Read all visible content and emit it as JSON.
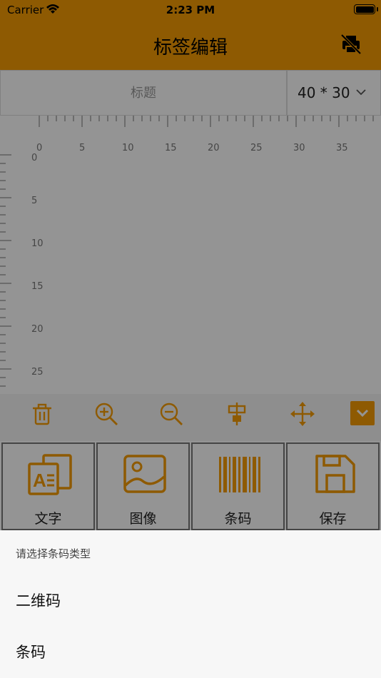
{
  "status_bar": {
    "carrier": "Carrier",
    "time": "2:23 PM"
  },
  "nav": {
    "title": "标签编辑",
    "right_icon": "printer-off-icon"
  },
  "header": {
    "title_placeholder": "标题",
    "size_value": "40 * 30"
  },
  "ruler": {
    "horizontal": [
      "0",
      "5",
      "10",
      "15",
      "20",
      "25",
      "30",
      "35"
    ],
    "vertical": [
      "0",
      "5",
      "10",
      "15",
      "20",
      "25"
    ]
  },
  "toolbar": {
    "items": [
      "trash-icon",
      "zoom-in-icon",
      "zoom-out-icon",
      "align-center-icon",
      "move-icon",
      "chevron-down-icon"
    ]
  },
  "grid": {
    "items": [
      {
        "label": "文字",
        "icon": "text-icon"
      },
      {
        "label": "图像",
        "icon": "image-icon"
      },
      {
        "label": "条码",
        "icon": "barcode-icon"
      },
      {
        "label": "保存",
        "icon": "save-icon"
      }
    ]
  },
  "sheet": {
    "title": "请选择条码类型",
    "options": [
      "二维码",
      "条码"
    ]
  },
  "colors": {
    "accent": "#f49c04",
    "accent_dim": "#8a5802"
  }
}
